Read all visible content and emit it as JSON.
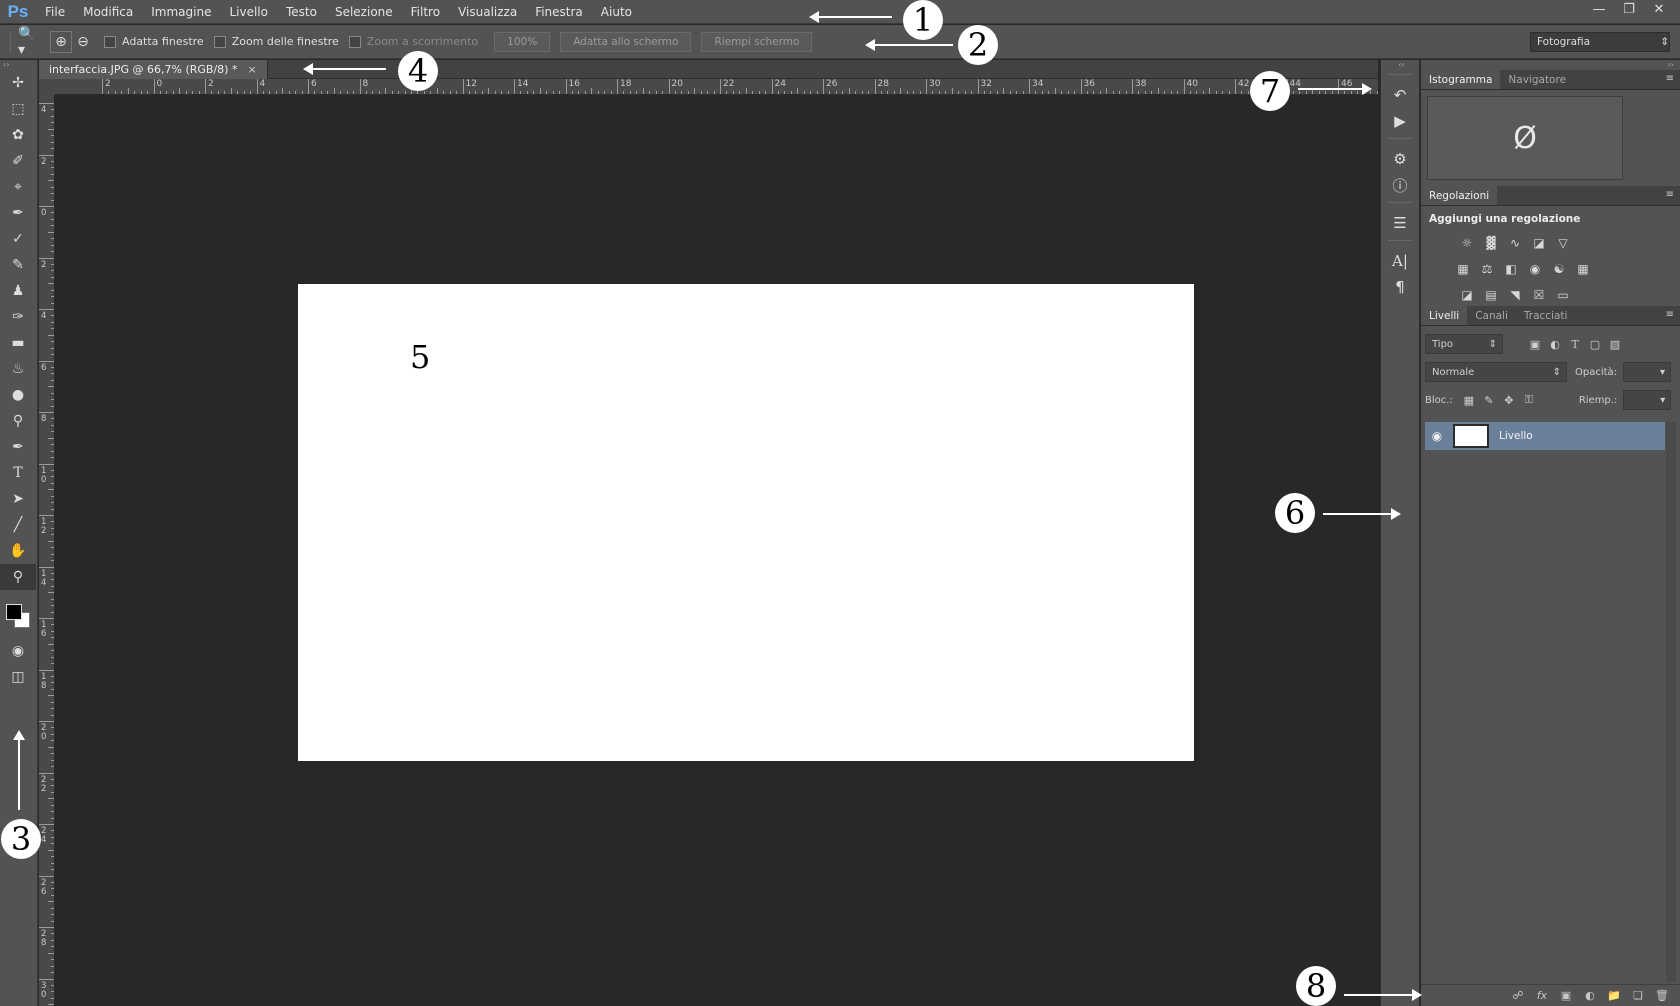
{
  "app": {
    "logo": "Ps",
    "menu": [
      "File",
      "Modifica",
      "Immagine",
      "Livello",
      "Testo",
      "Selezione",
      "Filtro",
      "Visualizza",
      "Finestra",
      "Aiuto"
    ],
    "window_controls": [
      "minimize-icon",
      "restore-icon",
      "close-icon"
    ]
  },
  "options_bar": {
    "checks": [
      {
        "label": "Adatta finestre",
        "enabled": true
      },
      {
        "label": "Zoom delle finestre",
        "enabled": true
      },
      {
        "label": "Zoom a scorrimento",
        "enabled": false
      }
    ],
    "buttons": [
      "100%",
      "Adatta allo schermo",
      "Riempi schermo"
    ],
    "workspace": "Fotografia"
  },
  "document": {
    "tab_title": "interfaccia.JPG @ 66,7% (RGB/8) *",
    "close": "×"
  },
  "rulers": {
    "top_labels": [
      "2",
      "0",
      "2",
      "4",
      "6",
      "8",
      "10",
      "12",
      "14",
      "16",
      "18",
      "20",
      "22",
      "24",
      "26",
      "28",
      "30",
      "32",
      "34",
      "36",
      "38",
      "40",
      "42",
      "44",
      "46"
    ],
    "left_labels": [
      "4",
      "2",
      "0",
      "2",
      "4",
      "6",
      "8",
      "10",
      "12",
      "14",
      "16",
      "18",
      "20",
      "22",
      "24",
      "26",
      "28",
      "30"
    ]
  },
  "panels": {
    "histogram_tabs": [
      "Istogramma",
      "Navigatore"
    ],
    "histogram_symbol": "Ø",
    "adjustments_tab": "Regolazioni",
    "adjustments_title": "Aggiungi una regolazione",
    "layers_tabs": [
      "Livelli",
      "Canali",
      "Tracciati"
    ],
    "filter_kind": "Tipo",
    "blend_mode": "Normale",
    "opacity_label": "Opacità:",
    "lock_label": "Bloc.:",
    "fill_label": "Riemp.:",
    "layer_name": "Livello"
  },
  "annotations": [
    "1",
    "2",
    "3",
    "4",
    "5",
    "6",
    "7",
    "8"
  ],
  "colors": {
    "bg_dark": "#282828",
    "panel": "#535353",
    "selected_layer": "#6a7f9a"
  }
}
